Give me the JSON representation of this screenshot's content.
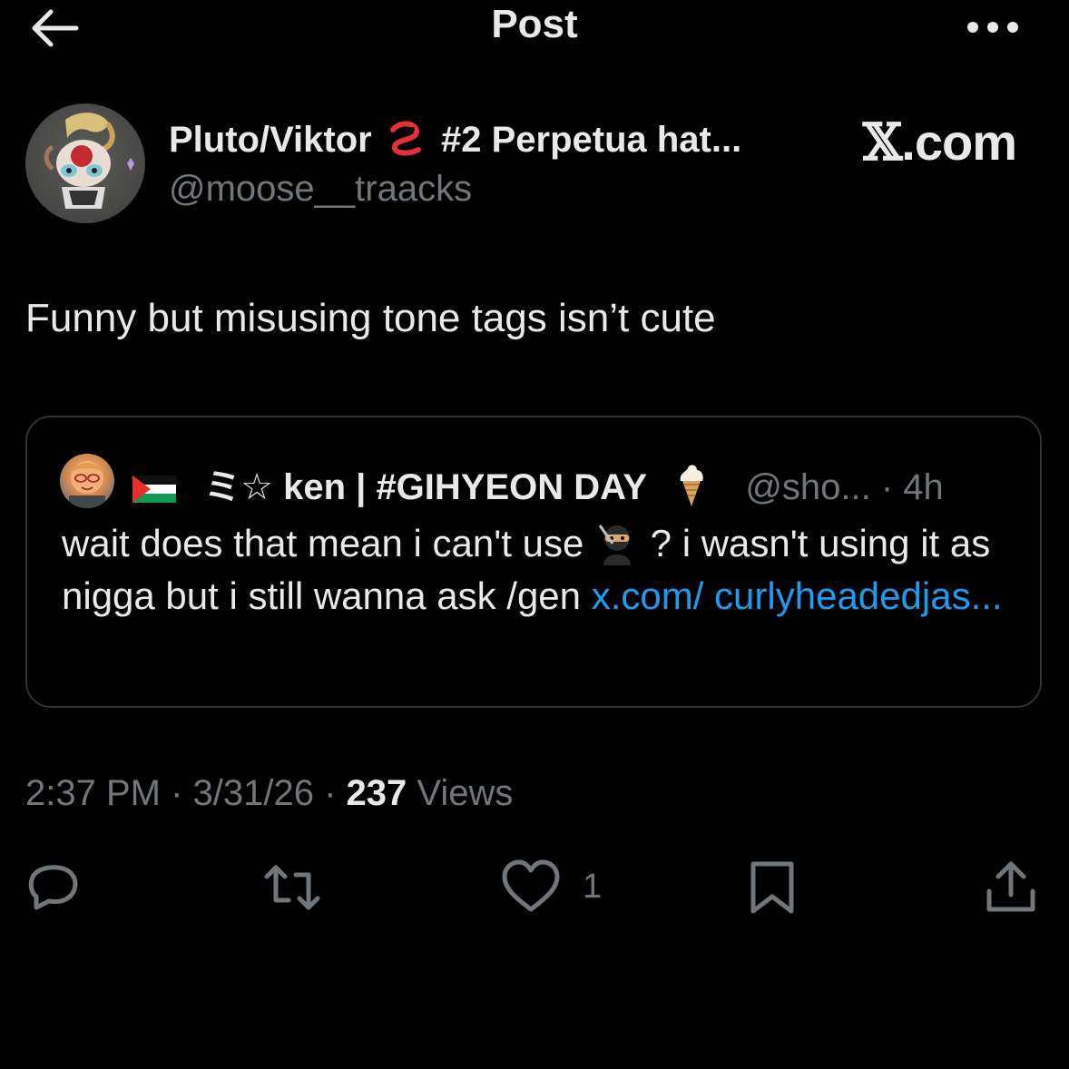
{
  "header": {
    "title": "Post",
    "back_icon": "arrow-left-icon",
    "more_icon": "more-horizontal-icon"
  },
  "author": {
    "display_name": "Pluto/Viktor",
    "name_emoji": "worm",
    "name_suffix": "#2 Perpetua hat...",
    "handle": "@moose__traacks",
    "source_badge": ".com",
    "source_badge_glyph": "𝕏"
  },
  "post": {
    "text": "Funny but misusing tone tags isn’t cute"
  },
  "quote": {
    "flag_emoji": "palestine-flag",
    "name": "ミ☆ ken | #GIHYEON DAY",
    "name_emoji": "ice-cream",
    "handle_time": "@sho... · 4h",
    "text_part1": "wait does that mean i can't use ",
    "emoji": "ninja",
    "text_part2": " ? i wasn't using it as nigga but i still wanna ask /gen ",
    "link_text": "x.com/ curlyheadedjas..."
  },
  "meta": {
    "time": "2:37 PM",
    "separator": " · ",
    "date": "3/31/26",
    "views_count": "237",
    "views_label": " Views"
  },
  "actions": {
    "reply_icon": "reply-icon",
    "repost_icon": "repost-icon",
    "like_icon": "heart-icon",
    "like_count": "1",
    "bookmark_icon": "bookmark-icon",
    "share_icon": "share-icon"
  },
  "colors": {
    "background": "#000000",
    "primary_text": "#e7e9ea",
    "secondary_text": "#71767b",
    "link": "#1d9bf0",
    "border": "#2f3336"
  }
}
